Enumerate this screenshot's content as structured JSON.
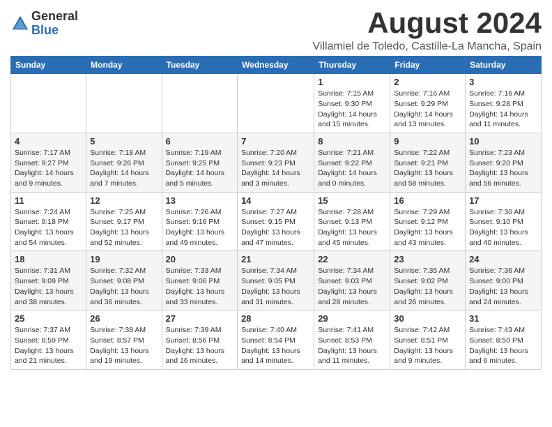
{
  "logo": {
    "general": "General",
    "blue": "Blue"
  },
  "header": {
    "month": "August 2024",
    "location": "Villamiel de Toledo, Castille-La Mancha, Spain"
  },
  "weekdays": [
    "Sunday",
    "Monday",
    "Tuesday",
    "Wednesday",
    "Thursday",
    "Friday",
    "Saturday"
  ],
  "weeks": [
    [
      {
        "day": "",
        "info": ""
      },
      {
        "day": "",
        "info": ""
      },
      {
        "day": "",
        "info": ""
      },
      {
        "day": "",
        "info": ""
      },
      {
        "day": "1",
        "info": "Sunrise: 7:15 AM\nSunset: 9:30 PM\nDaylight: 14 hours\nand 15 minutes."
      },
      {
        "day": "2",
        "info": "Sunrise: 7:16 AM\nSunset: 9:29 PM\nDaylight: 14 hours\nand 13 minutes."
      },
      {
        "day": "3",
        "info": "Sunrise: 7:16 AM\nSunset: 9:28 PM\nDaylight: 14 hours\nand 11 minutes."
      }
    ],
    [
      {
        "day": "4",
        "info": "Sunrise: 7:17 AM\nSunset: 9:27 PM\nDaylight: 14 hours\nand 9 minutes."
      },
      {
        "day": "5",
        "info": "Sunrise: 7:18 AM\nSunset: 9:26 PM\nDaylight: 14 hours\nand 7 minutes."
      },
      {
        "day": "6",
        "info": "Sunrise: 7:19 AM\nSunset: 9:25 PM\nDaylight: 14 hours\nand 5 minutes."
      },
      {
        "day": "7",
        "info": "Sunrise: 7:20 AM\nSunset: 9:23 PM\nDaylight: 14 hours\nand 3 minutes."
      },
      {
        "day": "8",
        "info": "Sunrise: 7:21 AM\nSunset: 9:22 PM\nDaylight: 14 hours\nand 0 minutes."
      },
      {
        "day": "9",
        "info": "Sunrise: 7:22 AM\nSunset: 9:21 PM\nDaylight: 13 hours\nand 58 minutes."
      },
      {
        "day": "10",
        "info": "Sunrise: 7:23 AM\nSunset: 9:20 PM\nDaylight: 13 hours\nand 56 minutes."
      }
    ],
    [
      {
        "day": "11",
        "info": "Sunrise: 7:24 AM\nSunset: 9:18 PM\nDaylight: 13 hours\nand 54 minutes."
      },
      {
        "day": "12",
        "info": "Sunrise: 7:25 AM\nSunset: 9:17 PM\nDaylight: 13 hours\nand 52 minutes."
      },
      {
        "day": "13",
        "info": "Sunrise: 7:26 AM\nSunset: 9:16 PM\nDaylight: 13 hours\nand 49 minutes."
      },
      {
        "day": "14",
        "info": "Sunrise: 7:27 AM\nSunset: 9:15 PM\nDaylight: 13 hours\nand 47 minutes."
      },
      {
        "day": "15",
        "info": "Sunrise: 7:28 AM\nSunset: 9:13 PM\nDaylight: 13 hours\nand 45 minutes."
      },
      {
        "day": "16",
        "info": "Sunrise: 7:29 AM\nSunset: 9:12 PM\nDaylight: 13 hours\nand 43 minutes."
      },
      {
        "day": "17",
        "info": "Sunrise: 7:30 AM\nSunset: 9:10 PM\nDaylight: 13 hours\nand 40 minutes."
      }
    ],
    [
      {
        "day": "18",
        "info": "Sunrise: 7:31 AM\nSunset: 9:09 PM\nDaylight: 13 hours\nand 38 minutes."
      },
      {
        "day": "19",
        "info": "Sunrise: 7:32 AM\nSunset: 9:08 PM\nDaylight: 13 hours\nand 36 minutes."
      },
      {
        "day": "20",
        "info": "Sunrise: 7:33 AM\nSunset: 9:06 PM\nDaylight: 13 hours\nand 33 minutes."
      },
      {
        "day": "21",
        "info": "Sunrise: 7:34 AM\nSunset: 9:05 PM\nDaylight: 13 hours\nand 31 minutes."
      },
      {
        "day": "22",
        "info": "Sunrise: 7:34 AM\nSunset: 9:03 PM\nDaylight: 13 hours\nand 28 minutes."
      },
      {
        "day": "23",
        "info": "Sunrise: 7:35 AM\nSunset: 9:02 PM\nDaylight: 13 hours\nand 26 minutes."
      },
      {
        "day": "24",
        "info": "Sunrise: 7:36 AM\nSunset: 9:00 PM\nDaylight: 13 hours\nand 24 minutes."
      }
    ],
    [
      {
        "day": "25",
        "info": "Sunrise: 7:37 AM\nSunset: 8:59 PM\nDaylight: 13 hours\nand 21 minutes."
      },
      {
        "day": "26",
        "info": "Sunrise: 7:38 AM\nSunset: 8:57 PM\nDaylight: 13 hours\nand 19 minutes."
      },
      {
        "day": "27",
        "info": "Sunrise: 7:39 AM\nSunset: 8:56 PM\nDaylight: 13 hours\nand 16 minutes."
      },
      {
        "day": "28",
        "info": "Sunrise: 7:40 AM\nSunset: 8:54 PM\nDaylight: 13 hours\nand 14 minutes."
      },
      {
        "day": "29",
        "info": "Sunrise: 7:41 AM\nSunset: 8:53 PM\nDaylight: 13 hours\nand 11 minutes."
      },
      {
        "day": "30",
        "info": "Sunrise: 7:42 AM\nSunset: 8:51 PM\nDaylight: 13 hours\nand 9 minutes."
      },
      {
        "day": "31",
        "info": "Sunrise: 7:43 AM\nSunset: 8:50 PM\nDaylight: 13 hours\nand 6 minutes."
      }
    ]
  ]
}
